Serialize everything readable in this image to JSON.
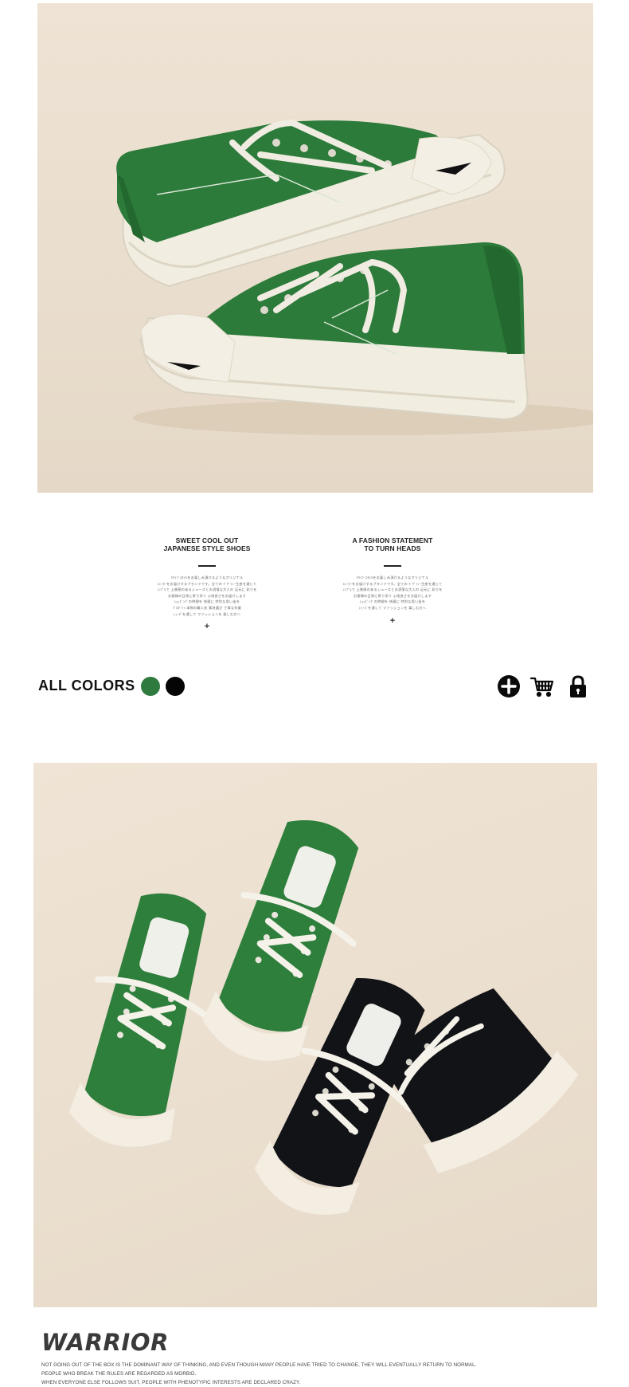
{
  "hero": {
    "image_alt": "Two green canvas low-top sneakers stacked on each other"
  },
  "taglines": [
    {
      "title_line1": "SWEET COOL OUT",
      "title_line2": "JAPANESE STYLE SHOES",
      "body": "ﾏﾗｲﾌ･ｽﾀｲﾙをお楽しみ頂けるようなオリジナル\nｽﾆｰｶｰをお届けするブランドです。全ての ﾃﾞｻﾞｲﾝ･生産を通じて\nｼﾝﾌﾟﾙで 上質感のあるシューズとお洒落な大人の 足元に 彩りを\nお客様の日常に寄り添う 心地良さをお届けします\nｼｮｯﾋﾟﾝｸﾞの時間を 快適に 特別な思い出を\nﾌﾟﾛﾀﾞｸﾄ 本物の職人技 素材選び 丁寧な作業\nｼｭｰｽﾞを通して ファッションを 楽しむ方へ",
      "plus": "+"
    },
    {
      "title_line1": "A FASHION STATEMENT",
      "title_line2": "TO TURN HEADS",
      "body": "ﾏﾗｲﾌ･ｽﾀｲﾙをお楽しみ頂けるようなオリジナル\nｽﾆｰｶｰをお届けするブランドです。全ての ﾃﾞｻﾞｲﾝ･生産を通じて\nｼﾝﾌﾟﾙで 上質感のあるシューズとお洒落な大人の 足元に 彩りを\nお客様の日常に寄り添う 心地良さをお届けします\nｼｮｯﾋﾟﾝｸﾞの時間を 快適に 特別な思い出を\nｼｭｰｽﾞを通して ファッションを 楽しむ方へ",
      "plus": "+"
    }
  ],
  "colors": {
    "label": "ALL COLORS",
    "swatches": [
      {
        "name": "green",
        "hex": "#2f7a3e"
      },
      {
        "name": "black",
        "hex": "#050505"
      }
    ]
  },
  "actions": [
    {
      "name": "add-icon"
    },
    {
      "name": "cart-icon"
    },
    {
      "name": "lock-icon"
    }
  ],
  "flatlay": {
    "image_alt": "Top-down view of a pair of green and a pair of black canvas sneakers"
  },
  "brand": {
    "title": "WARRIOR",
    "lines": [
      "NOT GOING OUT OF THE BOX IS THE DOMINANT WAY OF THINKING, AND EVEN THOUGH MANY PEOPLE HAVE TRIED TO CHANGE, THEY WILL EVENTUALLY RETURN TO NORMAL.",
      "PEOPLE WHO BREAK THE RULES ARE REGARDED AS MORBID.",
      "WHEN EVERYONE ELSE FOLLOWS SUIT, PEOPLE WITH PHENOTYPIC INTERESTS ARE DECLARED CRAZY."
    ]
  }
}
